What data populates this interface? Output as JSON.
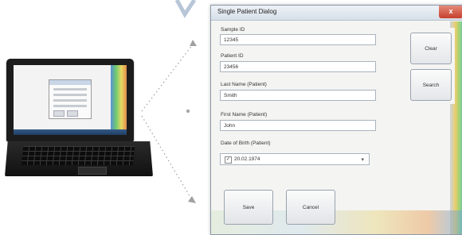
{
  "dialog": {
    "title": "Single Patient Dialog",
    "close_glyph": "x",
    "fields": [
      {
        "label": "Sample ID",
        "value": "12345"
      },
      {
        "label": "Patient ID",
        "value": "23456"
      },
      {
        "label": "Last Name (Patient)",
        "value": "Smith"
      },
      {
        "label": "First Name (Patient)",
        "value": "John"
      }
    ],
    "dob": {
      "label": "Date of Birth (Patient)",
      "checked_glyph": "✓",
      "value": "20.02.1974",
      "dropdown_glyph": "▾"
    },
    "buttons": {
      "clear": "Clear",
      "search": "Search",
      "save": "Save",
      "cancel": "Cancel"
    }
  },
  "colors": {
    "accent_close": "#c6402c",
    "titlebar": "#d6dfe9",
    "callout_dots": "#9a9a9a"
  }
}
